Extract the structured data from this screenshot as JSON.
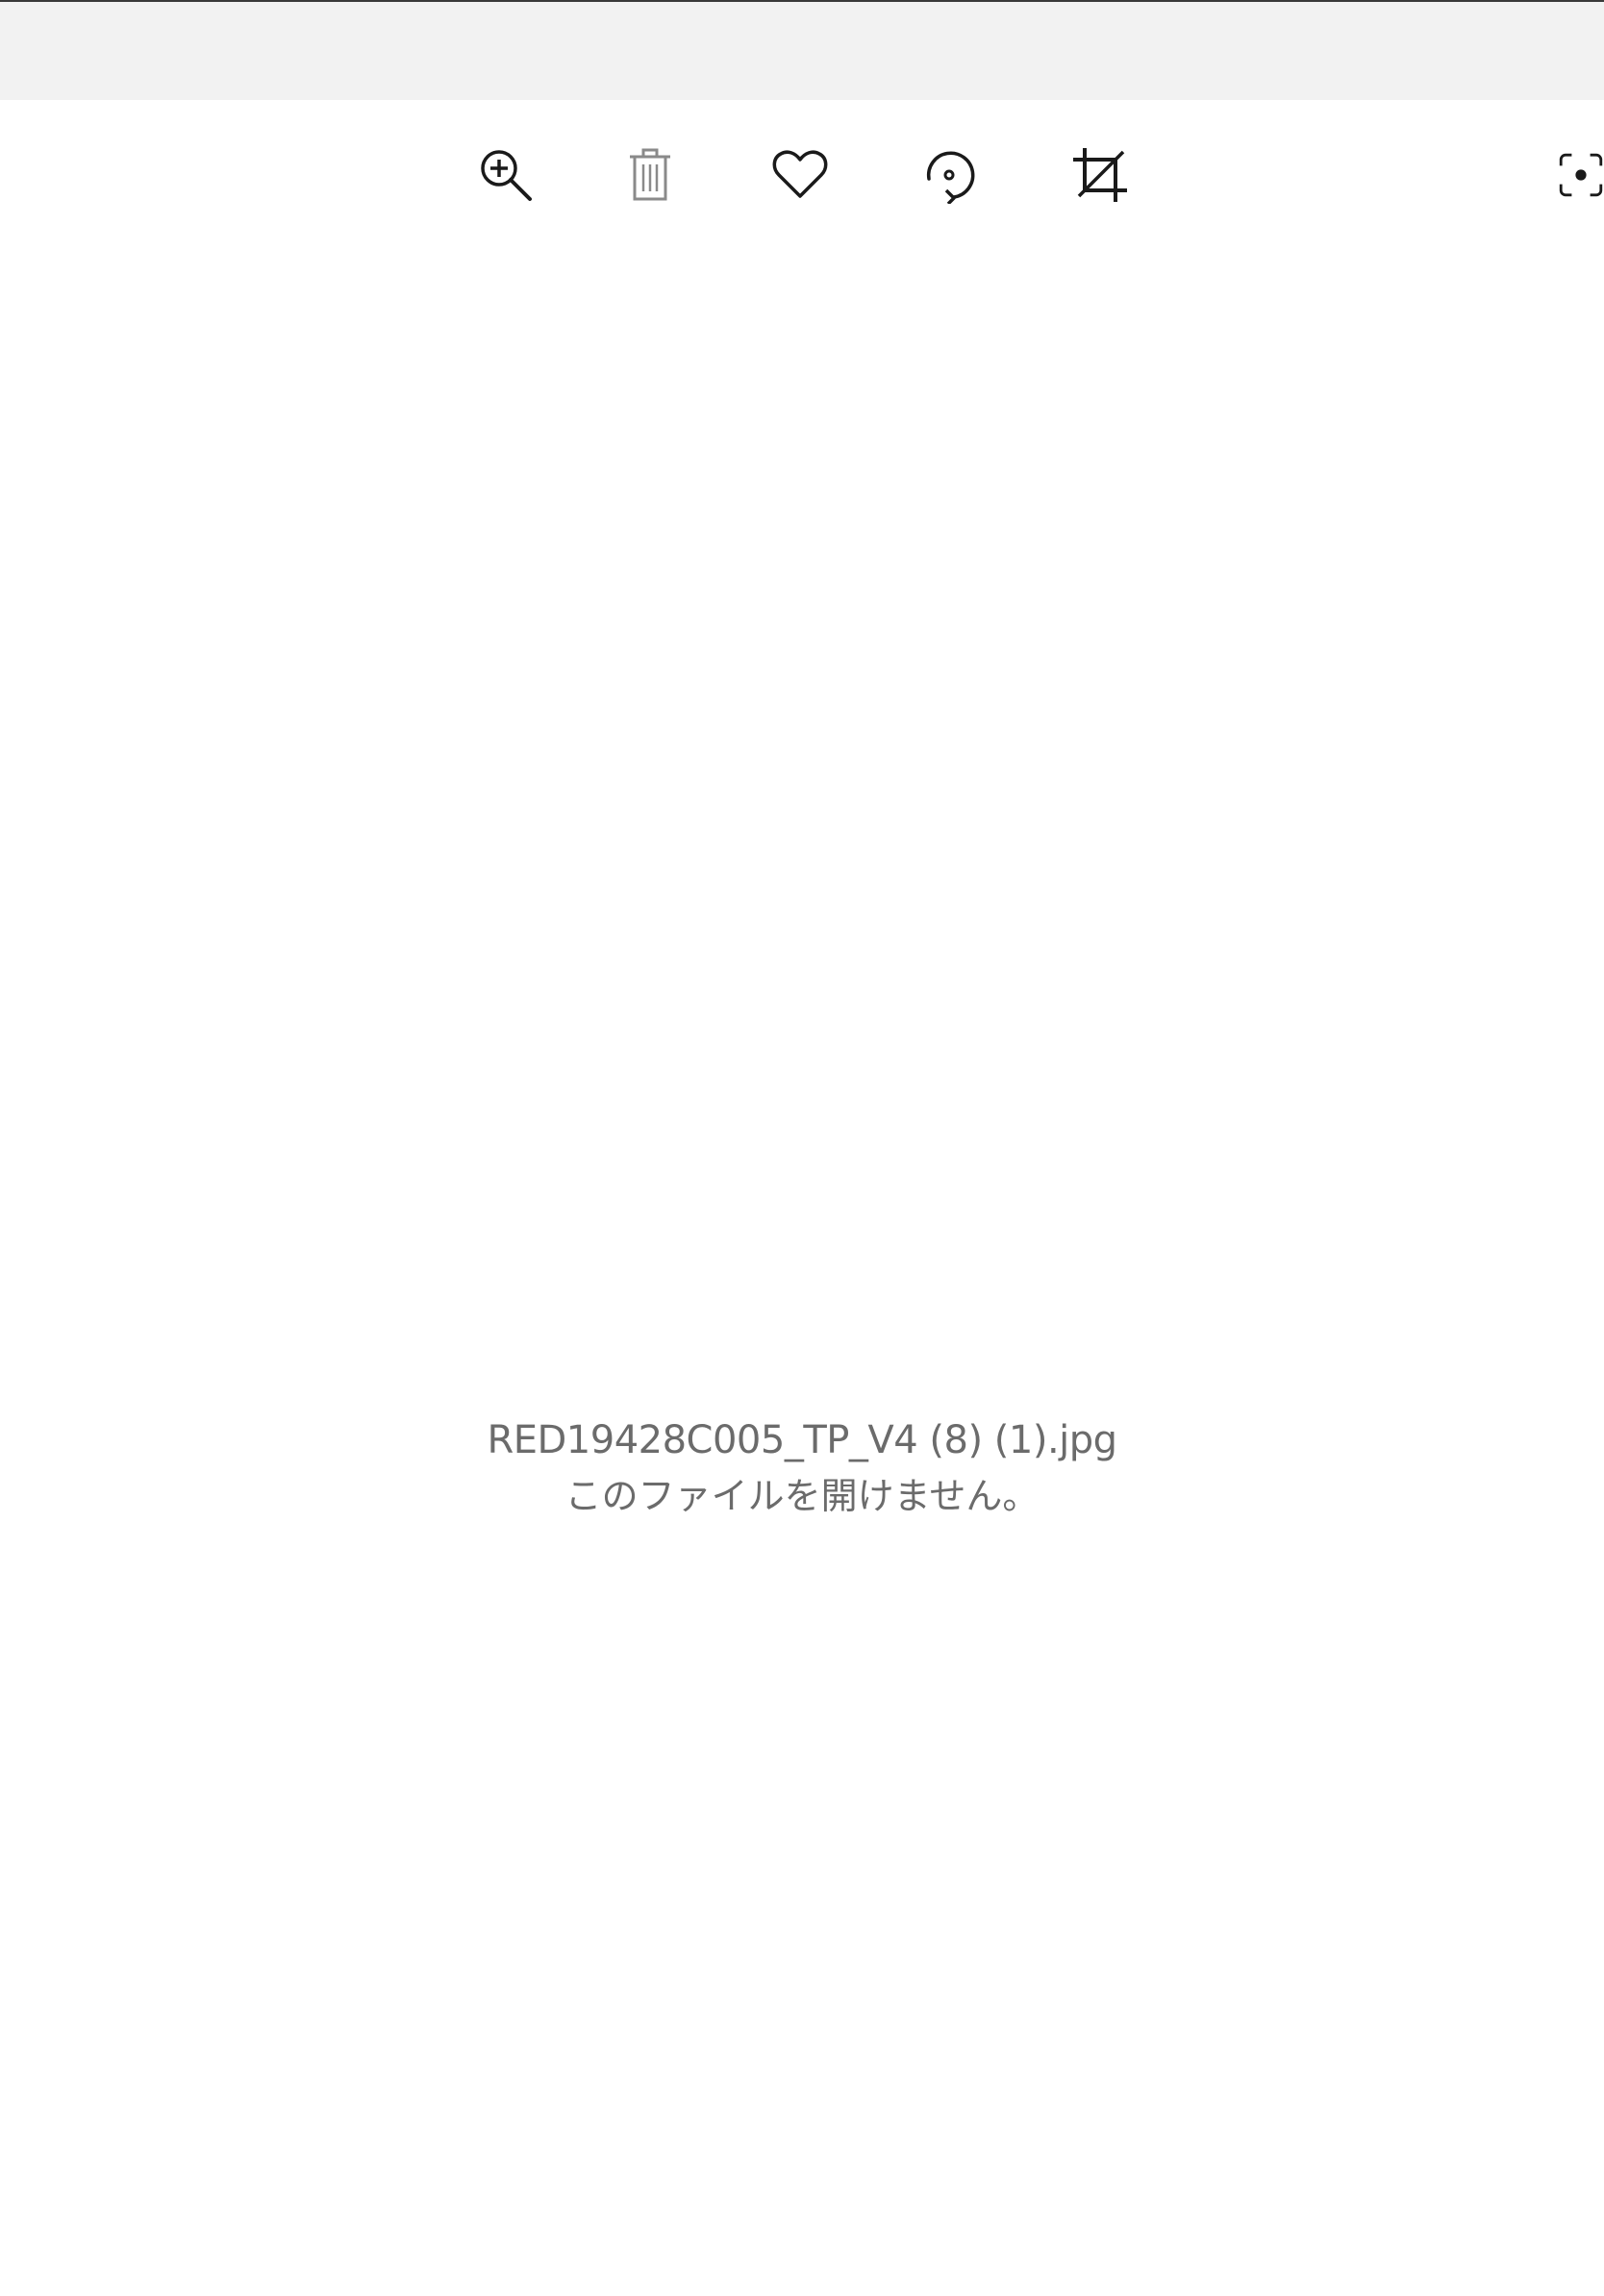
{
  "toolbar": {
    "buttons": [
      {
        "icon": "zoom-in-icon"
      },
      {
        "icon": "delete-icon",
        "disabled": true
      },
      {
        "icon": "heart-icon"
      },
      {
        "icon": "rotate-icon"
      },
      {
        "icon": "crop-icon"
      },
      {
        "icon": "visual-search-icon"
      }
    ]
  },
  "viewer": {
    "file_name": "RED19428C005_TP_V4 (8) (1).jpg",
    "error_message": "このファイルを開けません。"
  },
  "colors": {
    "titlebar": "#f2f2f2",
    "icon": "#1a1a1a",
    "icon_disabled": "#8a8a8a",
    "message_text": "#6b6b6b"
  }
}
